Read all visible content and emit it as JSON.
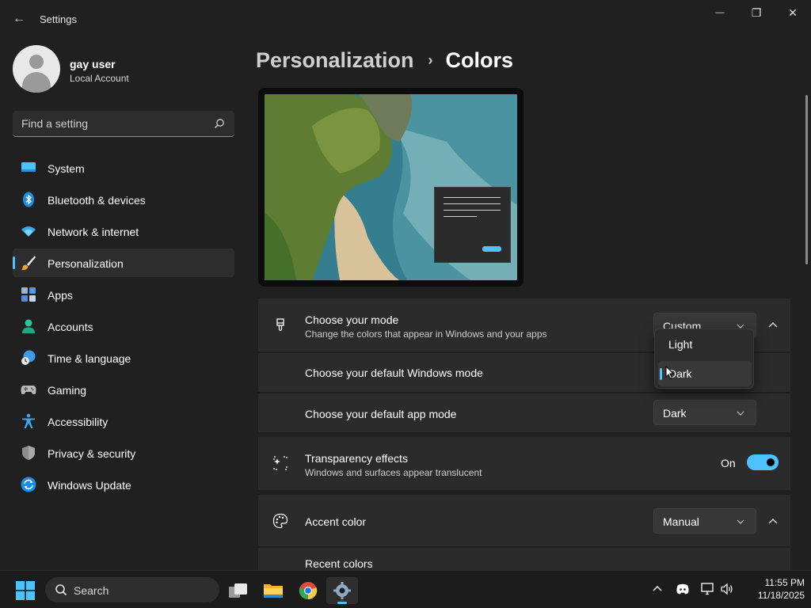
{
  "window": {
    "title": "Settings",
    "back_glyph": "←",
    "minimize_glyph": "—",
    "maximize_glyph": "❐",
    "close_glyph": "✕"
  },
  "user": {
    "name": "gay user",
    "account_type": "Local Account"
  },
  "search": {
    "placeholder": "Find a setting"
  },
  "sidebar": {
    "items": [
      {
        "label": "System",
        "icon": "system-icon"
      },
      {
        "label": "Bluetooth & devices",
        "icon": "bluetooth-icon"
      },
      {
        "label": "Network & internet",
        "icon": "wifi-icon"
      },
      {
        "label": "Personalization",
        "icon": "paintbrush-icon",
        "active": true
      },
      {
        "label": "Apps",
        "icon": "apps-icon"
      },
      {
        "label": "Accounts",
        "icon": "person-icon"
      },
      {
        "label": "Time & language",
        "icon": "globe-clock-icon"
      },
      {
        "label": "Gaming",
        "icon": "gamepad-icon"
      },
      {
        "label": "Accessibility",
        "icon": "accessibility-icon"
      },
      {
        "label": "Privacy & security",
        "icon": "shield-icon"
      },
      {
        "label": "Windows Update",
        "icon": "update-icon"
      }
    ]
  },
  "breadcrumb": {
    "parent": "Personalization",
    "separator": "›",
    "current": "Colors"
  },
  "mode": {
    "title": "Choose your mode",
    "subtitle": "Change the colors that appear in Windows and your apps",
    "value": "Custom",
    "windows_mode_label": "Choose your default Windows mode",
    "app_mode_label": "Choose your default app mode",
    "app_mode_value": "Dark",
    "dropdown_options": [
      "Light",
      "Dark"
    ],
    "dropdown_selected": "Dark"
  },
  "transparency": {
    "title": "Transparency effects",
    "subtitle": "Windows and surfaces appear translucent",
    "state_label": "On",
    "on": true
  },
  "accent": {
    "title": "Accent color",
    "value": "Manual",
    "recent_label": "Recent colors"
  },
  "taskbar": {
    "search_label": "Search",
    "time": "11:55 PM",
    "date": "11/18/2025"
  },
  "colors": {
    "accent": "#4cc2ff",
    "background": "#202020",
    "card": "#2b2b2b"
  }
}
